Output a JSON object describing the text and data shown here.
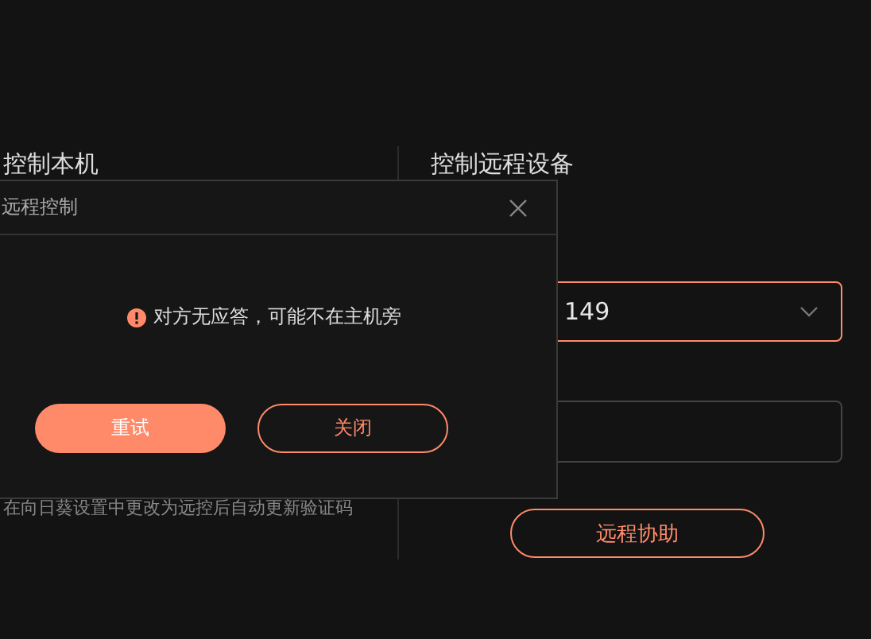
{
  "left_panel": {
    "heading": "控制本机",
    "hint": "在向日葵设置中更改为远控后自动更新验证码"
  },
  "right_panel": {
    "heading": "控制远程设备",
    "device_select": {
      "value": "149"
    },
    "assist_button": "远程协助"
  },
  "dialog": {
    "title": "远程控制",
    "message": "对方无应答，可能不在主机旁",
    "buttons": [
      {
        "label": "重试",
        "kind": "primary"
      },
      {
        "label": "关闭",
        "kind": "secondary"
      }
    ]
  }
}
